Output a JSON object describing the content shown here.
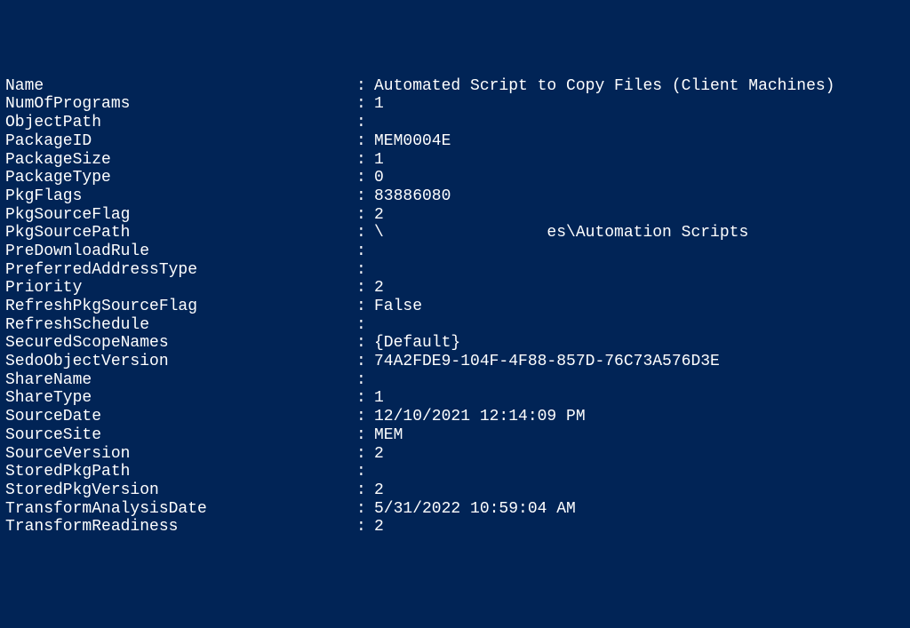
{
  "separator": ":",
  "rows": [
    {
      "label": "Name",
      "value": "Automated Script to Copy Files (Client Machines)"
    },
    {
      "label": "NumOfPrograms",
      "value": "1"
    },
    {
      "label": "ObjectPath",
      "value": ""
    },
    {
      "label": "PackageID",
      "value": "MEM0004E"
    },
    {
      "label": "PackageSize",
      "value": "1"
    },
    {
      "label": "PackageType",
      "value": "0"
    },
    {
      "label": "PkgFlags",
      "value": "83886080"
    },
    {
      "label": "PkgSourceFlag",
      "value": "2"
    },
    {
      "label": "PkgSourcePath",
      "value": "\\                 es\\Automation Scripts"
    },
    {
      "label": "PreDownloadRule",
      "value": ""
    },
    {
      "label": "PreferredAddressType",
      "value": ""
    },
    {
      "label": "Priority",
      "value": "2"
    },
    {
      "label": "RefreshPkgSourceFlag",
      "value": "False"
    },
    {
      "label": "RefreshSchedule",
      "value": ""
    },
    {
      "label": "SecuredScopeNames",
      "value": "{Default}"
    },
    {
      "label": "SedoObjectVersion",
      "value": "74A2FDE9-104F-4F88-857D-76C73A576D3E"
    },
    {
      "label": "ShareName",
      "value": ""
    },
    {
      "label": "ShareType",
      "value": "1"
    },
    {
      "label": "SourceDate",
      "value": "12/10/2021 12:14:09 PM"
    },
    {
      "label": "SourceSite",
      "value": "MEM"
    },
    {
      "label": "SourceVersion",
      "value": "2"
    },
    {
      "label": "StoredPkgPath",
      "value": ""
    },
    {
      "label": "StoredPkgVersion",
      "value": "2"
    },
    {
      "label": "TransformAnalysisDate",
      "value": "5/31/2022 10:59:04 AM"
    },
    {
      "label": "TransformReadiness",
      "value": "2"
    }
  ]
}
